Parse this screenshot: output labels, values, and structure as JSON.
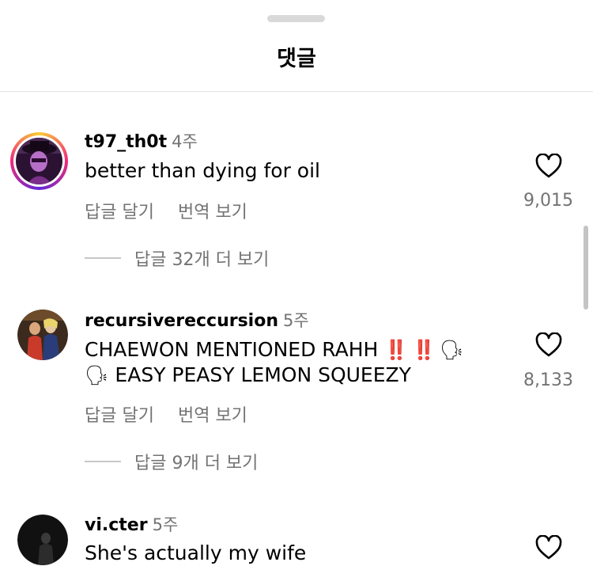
{
  "sheet": {
    "title": "댓글"
  },
  "comments": [
    {
      "username": "t97_th0t",
      "time": "4주",
      "text": "better than dying for oil",
      "reply_label": "답글 달기",
      "translate_label": "번역 보기",
      "view_replies": "답글 32개 더 보기",
      "likes": "9,015",
      "avatar_ring": true
    },
    {
      "username": "recursivereccursion",
      "time": "5주",
      "text_line1": "CHAEWON MENTIONED RAHH",
      "emoji_bang": "‼️",
      "emoji_speak": "🗣",
      "text_line2": "EASY PEASY LEMON SQUEEZY",
      "reply_label": "답글 달기",
      "translate_label": "번역 보기",
      "view_replies": "답글 9개 더 보기",
      "likes": "8,133",
      "avatar_ring": false
    },
    {
      "username": "vi.cter",
      "time": "5주",
      "text": "She's actually my wife",
      "avatar_ring": false
    }
  ],
  "icons": {
    "like": "heart-outline-icon"
  },
  "colors": {
    "secondary_text": "#737373",
    "divider": "#e3e3e3",
    "bang": "#e0261c"
  }
}
